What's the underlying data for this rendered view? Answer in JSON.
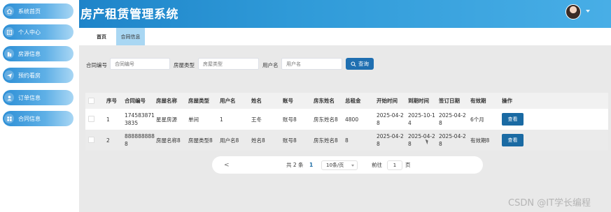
{
  "app": {
    "title": "房产租赁管理系统"
  },
  "sidebar": {
    "items": [
      {
        "label": "系统首页",
        "icon": "home-icon"
      },
      {
        "label": "个人中心",
        "icon": "profile-card-icon"
      },
      {
        "label": "房源信息",
        "icon": "building-icon"
      },
      {
        "label": "预约看房",
        "icon": "send-icon"
      },
      {
        "label": "订单信息",
        "icon": "user-icon"
      },
      {
        "label": "合同信息",
        "icon": "grid-icon"
      }
    ]
  },
  "tabs": [
    {
      "label": "首页"
    },
    {
      "label": "合同信息",
      "active": true
    }
  ],
  "filters": {
    "contract_no": {
      "label": "合同编号",
      "placeholder": "合同编号"
    },
    "house_type": {
      "label": "房屋类型",
      "placeholder": "房屋类型"
    },
    "username": {
      "label": "用户名",
      "placeholder": "用户名"
    },
    "search_label": "查询"
  },
  "table": {
    "headers": [
      "序号",
      "合同编号",
      "房屋名称",
      "房屋类型",
      "用户名",
      "姓名",
      "账号",
      "房东姓名",
      "总租金",
      "开始时间",
      "到期时间",
      "签订日期",
      "有效期",
      "操作"
    ],
    "rows": [
      {
        "index": "1",
        "contract_no_l1": "174583871",
        "contract_no_l2": "3835",
        "house_name": "星星房源",
        "house_type": "单间",
        "username": "1",
        "name": "王冬",
        "account": "账号8",
        "landlord": "房东姓名8",
        "total_rent": "4800",
        "start_l1": "2025-04-2",
        "start_l2": "8",
        "end_l1": "2025-10-1",
        "end_l2": "4",
        "signed_l1": "2025-04-2",
        "signed_l2": "8",
        "validity": "6个月",
        "action": "查看"
      },
      {
        "index": "2",
        "contract_no_l1": "888888888",
        "contract_no_l2": "8",
        "house_name": "房屋名称8",
        "house_type": "房屋类型8",
        "username": "用户名8",
        "name": "姓名8",
        "account": "账号8",
        "landlord": "房东姓名8",
        "total_rent": "8",
        "start_l1": "2025-04-2",
        "start_l2": "8",
        "end_l1": "2025-04-2",
        "end_l2": "8",
        "signed_l1": "2025-04-2",
        "signed_l2": "8",
        "validity": "有效期8",
        "action": "查看"
      }
    ]
  },
  "pagination": {
    "prev": "<",
    "total": "共 2 条",
    "current": "1",
    "page_size": "10条/页",
    "goto_label": "前往",
    "goto_value": "1",
    "page_unit": "页"
  },
  "watermark": "CSDN @IT学长编程",
  "colors": {
    "header": "#2f9ad8",
    "nav": "#4aa6e0",
    "primary_button": "#1a6aa3",
    "active_tab": "#a9d7f3"
  }
}
